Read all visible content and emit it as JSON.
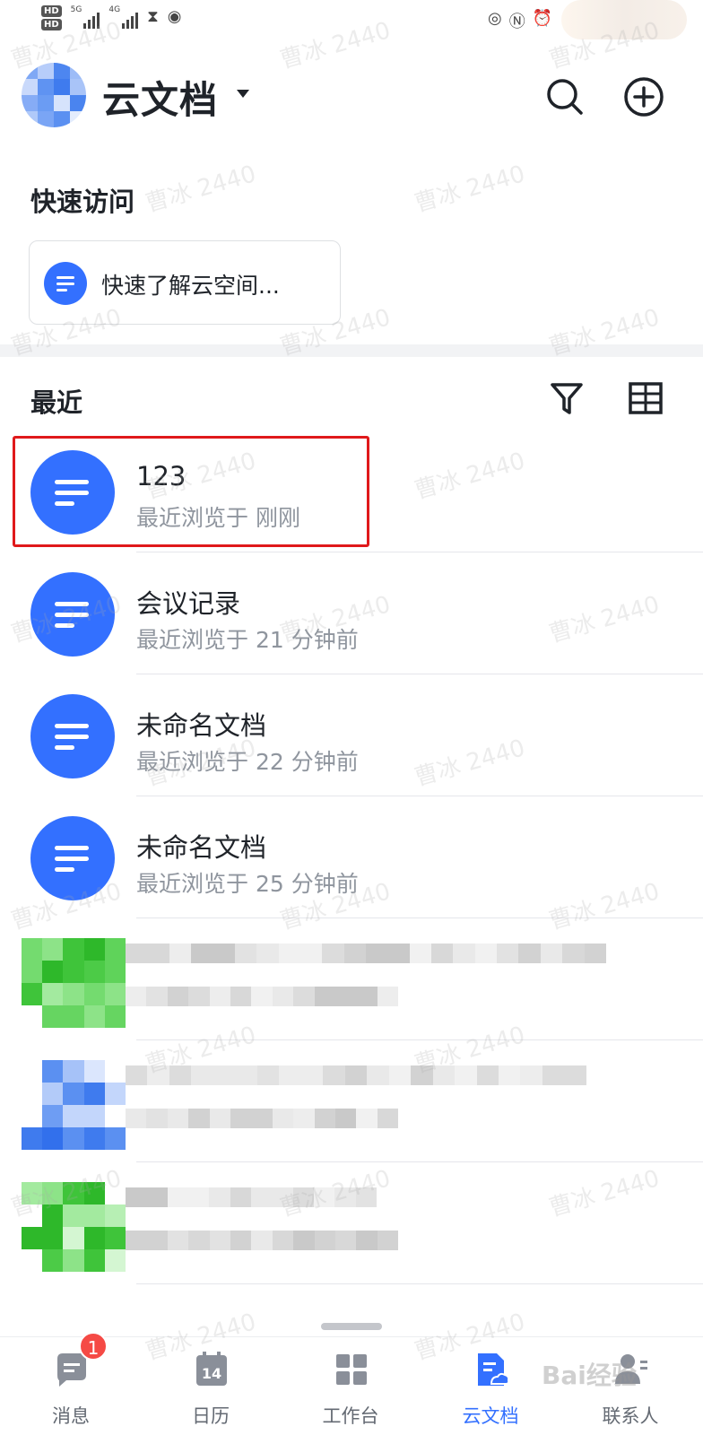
{
  "status_bar": {
    "sim1": "HD",
    "sim2": "HD",
    "network": "5G",
    "network2": "4G"
  },
  "header": {
    "title": "云文档",
    "logo_colors": [
      "#7fa8f5",
      "#b7cdfa",
      "#4d86f0",
      "#9dbcf7",
      "#c9d9fb",
      "#5f93f2",
      "#3f7bee",
      "#a9c4f8",
      "#86acf6",
      "#6b9cf3",
      "#d6e3fc",
      "#4a84ef",
      "#b0c9f9",
      "#7aa5f5",
      "#5b90f1",
      "#e3ecfd"
    ]
  },
  "quick_access": {
    "title": "快速访问",
    "items": [
      {
        "label": "快速了解云空间..."
      }
    ]
  },
  "recent": {
    "title": "最近",
    "items": [
      {
        "name": "123",
        "meta": "最近浏览于 刚刚",
        "highlighted": true
      },
      {
        "name": "会议记录",
        "meta": "最近浏览于 21 分钟前"
      },
      {
        "name": "未命名文档",
        "meta": "最近浏览于 22 分钟前"
      },
      {
        "name": "未命名文档",
        "meta": "最近浏览于 25 分钟前"
      }
    ],
    "redacted_rows": 3
  },
  "bottom_nav": {
    "tabs": [
      {
        "label": "消息",
        "badge": "1",
        "icon": "message-icon"
      },
      {
        "label": "日历",
        "icon": "calendar-icon",
        "day": "14"
      },
      {
        "label": "工作台",
        "icon": "workspace-icon"
      },
      {
        "label": "云文档",
        "icon": "docs-icon",
        "active": true
      },
      {
        "label": "联系人",
        "icon": "contacts-icon"
      }
    ]
  },
  "watermark": {
    "text": "曹冰 2440",
    "brand": "Bai经验"
  },
  "colors": {
    "accent": "#3370ff",
    "highlight_box": "#e0191b",
    "badge": "#f54a45",
    "secondary_text": "#8f959e"
  }
}
